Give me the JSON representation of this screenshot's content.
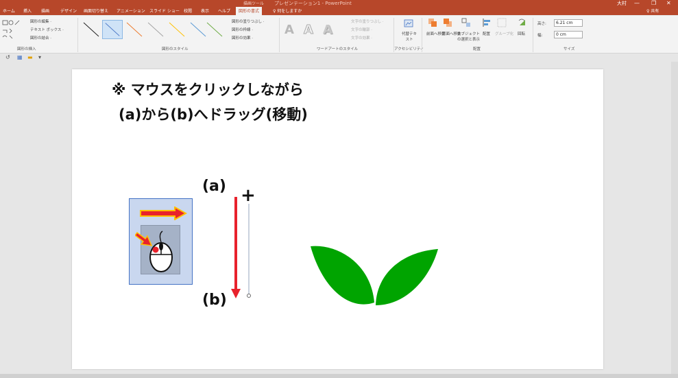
{
  "titlebar": {
    "context_label": "描画ツール",
    "title": "プレゼンテーション1 - PowerPoint",
    "user": "大村",
    "minimize": "—",
    "restore": "❐",
    "close": "✕"
  },
  "tabs": [
    {
      "label": "ホーム"
    },
    {
      "label": "挿入"
    },
    {
      "label": "描画"
    },
    {
      "label": "デザイン"
    },
    {
      "label": "画面切り替え"
    },
    {
      "label": "アニメーション"
    },
    {
      "label": "スライド ショー"
    },
    {
      "label": "校閲"
    },
    {
      "label": "表示"
    },
    {
      "label": "ヘルプ"
    },
    {
      "label": "図形の書式"
    }
  ],
  "tell_me": "♀ 何をしますか",
  "share": "♀ 共有",
  "ribbon": {
    "groups": {
      "insert_shapes": "図形の挿入",
      "shape_styles": "図形のスタイル",
      "wordart_styles": "ワードアートのスタイル",
      "accessibility": "アクセシビリティ",
      "arrange": "配置",
      "size": "サイズ"
    },
    "insert_shapes_items": [
      "図形の編集 ·",
      "テキスト ボックス ·",
      "図形の結合 ·"
    ],
    "shape_style_items": [
      "図形の塗りつぶし ·",
      "図形の枠線 ·",
      "図形の効果 ·"
    ],
    "wordart_items": [
      "文字の塗りつぶし ·",
      "文字の輪郭 ·",
      "文字の効果 ·"
    ],
    "wordart_letter": "A",
    "alt_text": "代替テキスト",
    "arrange_items": [
      "前面へ移動 ·",
      "背面へ移動 ·",
      "オブジェクトの選択と表示",
      "配置",
      "グループ化",
      "回転"
    ],
    "height_label": "高さ:",
    "height_value": "6.21 cm",
    "width_label": "幅:",
    "width_value": "0 cm"
  },
  "slide": {
    "instruction_line1": "※ マウスをクリックしながら",
    "instruction_line2": "(a)から(b)へドラッグ(移動)",
    "label_a": "(a)",
    "label_b": "(b)",
    "cursor_symbol": "+"
  },
  "colors": {
    "accent": "#b7472a",
    "arrow_red": "#e8222c",
    "arrow_orange": "#ffc000",
    "leaf_green": "#00a400",
    "box_fill": "#c9d7ef",
    "box_border": "#4472c4"
  }
}
